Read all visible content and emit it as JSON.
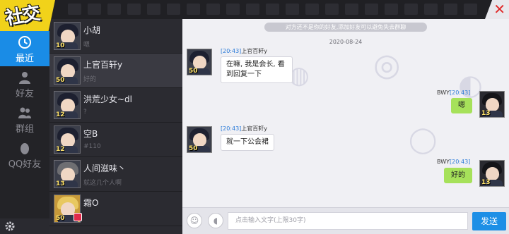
{
  "app": {
    "logo_text": "社交",
    "close_icon": "close-icon"
  },
  "nav": {
    "items": [
      {
        "label": "最近",
        "icon": "clock-icon",
        "active": true
      },
      {
        "label": "好友",
        "icon": "person-icon",
        "active": false
      },
      {
        "label": "群组",
        "icon": "group-icon",
        "active": false
      },
      {
        "label": "QQ好友",
        "icon": "qq-penguin-icon",
        "active": false
      }
    ],
    "settings_icon": "gear-icon"
  },
  "contacts": [
    {
      "name": "小胡",
      "message": "嗯",
      "level": "10",
      "selected": false
    },
    {
      "name": "上官百轩y",
      "message": "好的",
      "level": "50",
      "selected": true
    },
    {
      "name": "洪荒少女~dl",
      "message": "?",
      "level": "12",
      "selected": false
    },
    {
      "name": "空B",
      "message": "#110",
      "level": "12",
      "selected": false
    },
    {
      "name": "人间滋味丶",
      "message": "就这几个人啊",
      "level": "13",
      "selected": false
    },
    {
      "name": "霜O",
      "message": "",
      "level": "50",
      "selected": false
    }
  ],
  "chat": {
    "notice": "对方还不是你的好友,添加好友可以避免失去群聊",
    "date": "2020-08-24",
    "messages": [
      {
        "side": "left",
        "time": "[20:43]",
        "sender": "上官百轩y",
        "text": "在嘛, 我是会长, 看到回复一下",
        "level": "50"
      },
      {
        "side": "right",
        "time": "[20:43]",
        "sender": "BWY",
        "text": "嗯",
        "level": "13"
      },
      {
        "side": "left",
        "time": "[20:43]",
        "sender": "上官百轩y",
        "text": "就一下公会裙",
        "level": "50"
      },
      {
        "side": "right",
        "time": "[20:43]",
        "sender": "BWY",
        "text": "好的",
        "level": "13"
      }
    ]
  },
  "input": {
    "placeholder": "点击输入文字(上限30字)",
    "send_label": "发送",
    "emoji_icon": "emoji-icon",
    "voice_icon": "voice-icon"
  },
  "colors": {
    "accent": "#1d8fe6",
    "logo": "#f1d21a",
    "bubble_right": "#a6e15a",
    "time": "#2a7ad8"
  }
}
